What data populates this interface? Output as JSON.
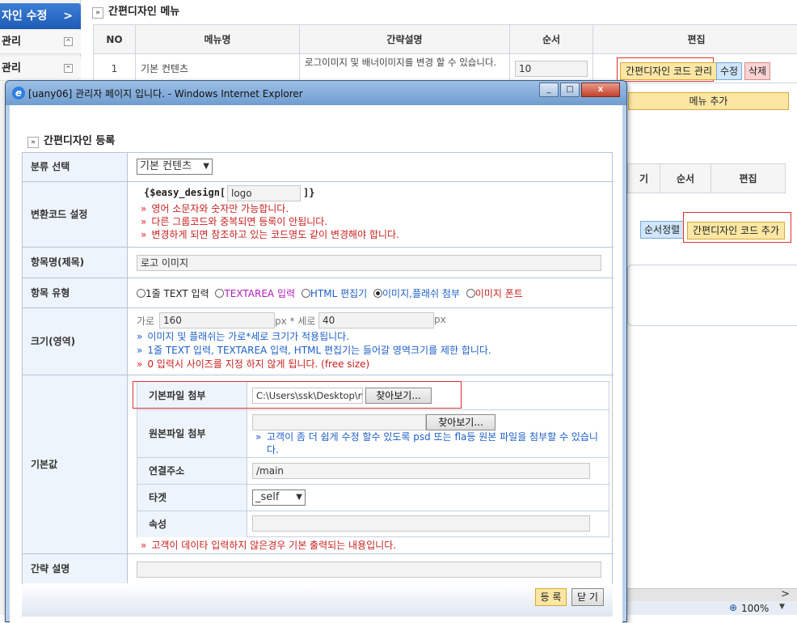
{
  "left_nav": {
    "header": "자인 수정",
    "header_arrow": ">",
    "items": [
      {
        "label": "관리",
        "toggle": "^"
      },
      {
        "label": "관리",
        "toggle": "^"
      }
    ]
  },
  "bg_page": {
    "title": "간편디자인 메뉴",
    "table": {
      "headers": [
        "NO",
        "메뉴명",
        "간략설명",
        "순서",
        "편집"
      ],
      "row": {
        "no": "1",
        "name": "기본 컨텐츠",
        "desc": "로그이미지 및 배너이미지를 변경 할 수 있습니다.",
        "order": "10",
        "btn_manage": "간편디자인 코드 관리",
        "btn_edit": "수정",
        "btn_delete": "삭제"
      }
    },
    "menu_add": "메뉴 추가",
    "table2_headers": [
      "기",
      "순서",
      "편집"
    ],
    "btn_sort": "순서정렬",
    "btn_code_add": "간편디자인 코드 추가",
    "zoom": "100%",
    "scroll_right": ">"
  },
  "ie_window": {
    "title": "[uany06] 관리자 페이지 입니다. - Windows Internet Explorer",
    "btn_min": "_",
    "btn_max": "□",
    "btn_close": "x"
  },
  "popup": {
    "title": "간편디자인 등록",
    "category": {
      "label": "분류 선택",
      "value": "기본 컨텐츠"
    },
    "code": {
      "label": "변환코드 설정",
      "prefix": "{$easy_design[",
      "value": "logo",
      "suffix": "]}",
      "notes": [
        "영어 소문자와 숫자만 가능합니다.",
        "다른 그룹코드와 중복되면 등록이 안됩니다.",
        "변경하게 되면 참조하고 있는 코드명도 같이 변경해야 합니다."
      ]
    },
    "item_name": {
      "label": "항목명(제목)",
      "value": "로고 이미지"
    },
    "item_type": {
      "label": "항목 유형",
      "options": [
        "1줄 TEXT 입력",
        "TEXTAREA 입력",
        "HTML 편집기",
        "이미지,플래쉬 첨부",
        "이미지 폰트"
      ],
      "option_colors": [
        "#222222",
        "#b01cc0",
        "#1d5fc8",
        "#1d5fc8",
        "#c81e1e"
      ],
      "selected": 3
    },
    "size": {
      "label": "크기(영역)",
      "width_label": "가로",
      "width_value": "160",
      "mid_label": "px * 세로",
      "height_value": "40",
      "unit": "px",
      "notes": [
        "이미지 및 플래쉬는 가로*세로 크기가 적용됩니다.",
        "1줄 TEXT 입력, TEXTAREA 입력, HTML 편집기는 들어갈 영역크기를 제한 합니다.",
        "0 입력시 사이즈를 지정 하지 않게 됩니다. (free size)"
      ]
    },
    "default": {
      "label": "기본값",
      "file": {
        "label": "기본파일 첨부",
        "value": "C:\\Users\\ssk\\Desktop\\no_",
        "browse": "찾아보기..."
      },
      "orig_file": {
        "label": "원본파일 첨부",
        "value": "",
        "browse": "찾아보기...",
        "note": "고객이 좀 더 쉽게 수정 할수 있도록 psd 또는 fla등 원본 파일을 첨부할 수 있습니다."
      },
      "link": {
        "label": "연결주소",
        "value": "/main"
      },
      "target": {
        "label": "타겟",
        "value": "_self"
      },
      "attr": {
        "label": "속성",
        "value": ""
      },
      "note": "고객이 데이타 입력하지 않은경우 기본 출력되는 내용입니다."
    },
    "brief": {
      "label": "간략 설명",
      "value": ""
    },
    "btn_register": "등 록",
    "btn_close": "닫 기"
  }
}
